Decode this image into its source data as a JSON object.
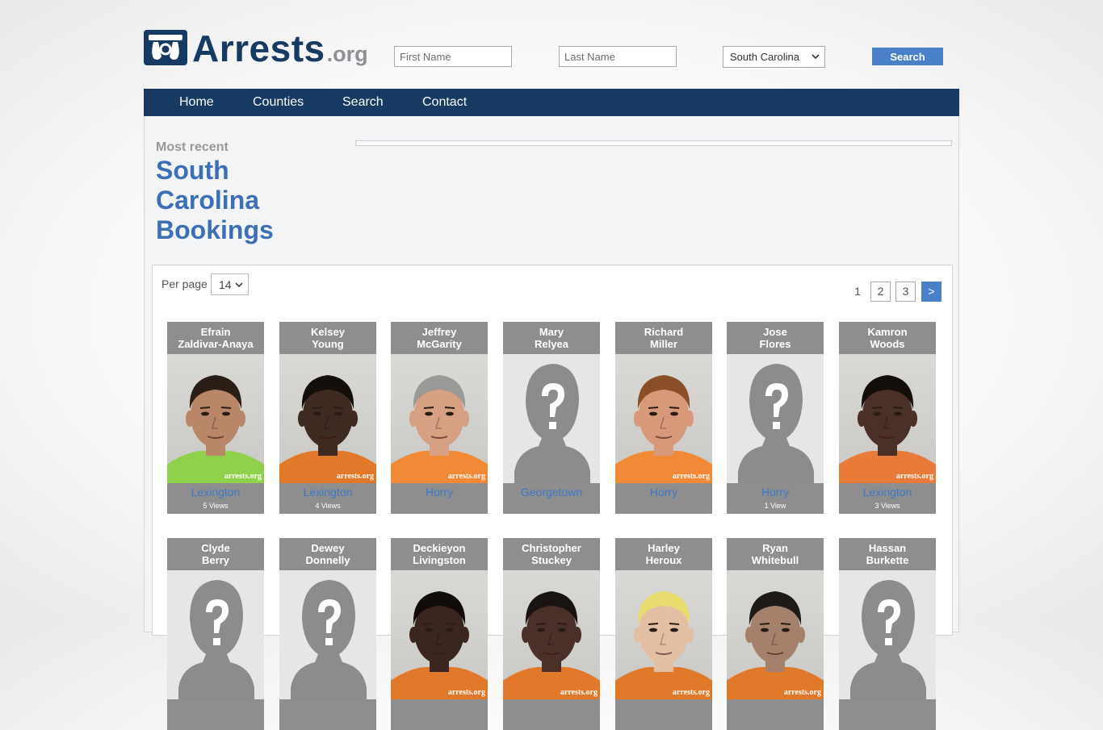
{
  "header": {
    "logo_text": "Arrests",
    "logo_suffix": ".org",
    "first_name_placeholder": "First Name",
    "last_name_placeholder": "Last Name",
    "state_selected": "South Carolina",
    "search_label": "Search"
  },
  "nav": [
    "Home",
    "Counties",
    "Search",
    "Contact"
  ],
  "main": {
    "subtitle": "Most recent",
    "title_lines": [
      "South",
      "Carolina",
      "Bookings"
    ]
  },
  "listing": {
    "per_page_label": "Per page",
    "per_page_value": "14",
    "pages": [
      "1",
      "2",
      "3",
      ">"
    ]
  },
  "bookings": [
    {
      "first": "Efrain",
      "last": "Zaldivar-Anaya",
      "county": "Lexington",
      "views": "5 Views",
      "photo": "mugshot",
      "skin": "#b98668",
      "shirt": "#8fd14a",
      "hair": "#2a1e16"
    },
    {
      "first": "Kelsey",
      "last": "Young",
      "county": "Lexington",
      "views": "4 Views",
      "photo": "mugshot",
      "skin": "#3e2a20",
      "shirt": "#e07a2a",
      "hair": "#150f0c"
    },
    {
      "first": "Jeffrey",
      "last": "McGarity",
      "county": "Horry",
      "views": "",
      "photo": "mugshot",
      "skin": "#d6a083",
      "shirt": "#f08a36",
      "hair": "#9c9a98"
    },
    {
      "first": "Mary",
      "last": "Relyea",
      "county": "Georgetown",
      "views": "",
      "photo": "placeholder"
    },
    {
      "first": "Richard",
      "last": "Miller",
      "county": "Horry",
      "views": "",
      "photo": "mugshot",
      "skin": "#d7997a",
      "shirt": "#f08a36",
      "hair": "#8a4f26"
    },
    {
      "first": "Jose",
      "last": "Flores",
      "county": "Horry",
      "views": "1 View",
      "photo": "placeholder"
    },
    {
      "first": "Kamron",
      "last": "Woods",
      "county": "Lexington",
      "views": "3 Views",
      "photo": "mugshot",
      "skin": "#4a3026",
      "shirt": "#e87a3a",
      "hair": "#140e0b"
    },
    {
      "first": "Clyde",
      "last": "Berry",
      "county": "",
      "views": "",
      "photo": "placeholder"
    },
    {
      "first": "Dewey",
      "last": "Donnelly",
      "county": "",
      "views": "",
      "photo": "placeholder"
    },
    {
      "first": "Deckieyon",
      "last": "Livingston",
      "county": "",
      "views": "",
      "photo": "mugshot",
      "skin": "#3a261e",
      "shirt": "#e07a2a",
      "hair": "#110c0a"
    },
    {
      "first": "Christopher",
      "last": "Stuckey",
      "county": "",
      "views": "",
      "photo": "mugshot",
      "skin": "#4a3028",
      "shirt": "#e07a2a",
      "hair": "#1a1410"
    },
    {
      "first": "Harley",
      "last": "Heroux",
      "county": "",
      "views": "",
      "photo": "mugshot",
      "skin": "#e3bfa4",
      "shirt": "#e07a2a",
      "hair": "#e8dc6e"
    },
    {
      "first": "Ryan",
      "last": "Whitebull",
      "county": "",
      "views": "",
      "photo": "mugshot",
      "skin": "#a5806a",
      "shirt": "#e07a2a",
      "hair": "#1e1a18"
    },
    {
      "first": "Hassan",
      "last": "Burkette",
      "county": "",
      "views": "",
      "photo": "placeholder"
    }
  ],
  "watermark": "arrests.org",
  "colors": {
    "brand_navy": "#163a62",
    "accent_blue": "#4a80c8",
    "title_blue": "#3c6fb6",
    "card_gray": "#8e8e8e"
  }
}
